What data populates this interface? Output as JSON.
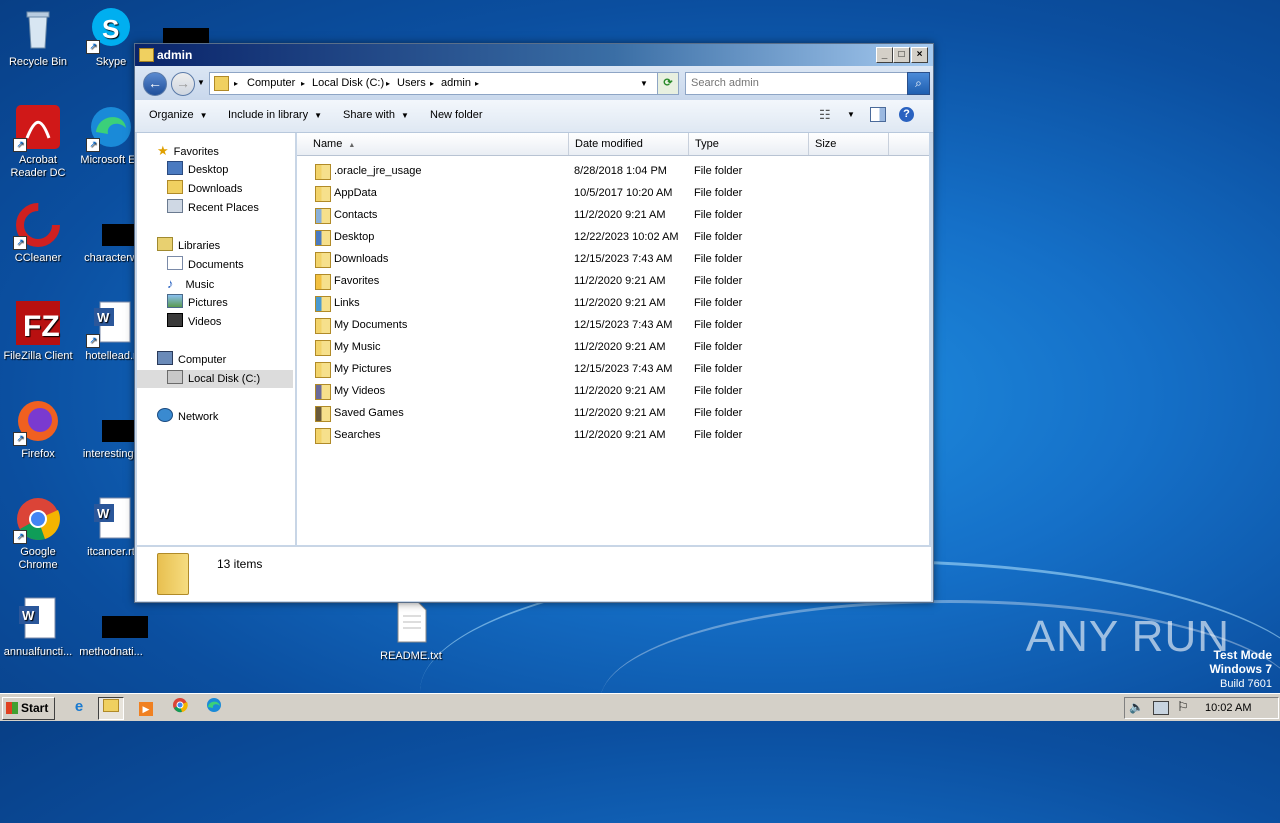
{
  "desktop": {
    "icons": [
      {
        "label": "Recycle Bin"
      },
      {
        "label": "Skype"
      },
      {
        "label": "Acrobat Reader DC"
      },
      {
        "label": "Microsoft Ed"
      },
      {
        "label": "CCleaner"
      },
      {
        "label": "characterw"
      },
      {
        "label": "FileZilla Client"
      },
      {
        "label": "hotellead.r"
      },
      {
        "label": "Firefox"
      },
      {
        "label": "interestingc"
      },
      {
        "label": "Google Chrome"
      },
      {
        "label": "itcancer.rt"
      },
      {
        "label": "annualfuncti..."
      },
      {
        "label": "methodnati..."
      },
      {
        "label": "README.txt"
      }
    ]
  },
  "window": {
    "title": "admin",
    "address": {
      "crumbs": [
        "Computer",
        "Local Disk (C:)",
        "Users",
        "admin"
      ]
    },
    "search": {
      "placeholder": "Search admin"
    },
    "toolbar": {
      "organize": "Organize",
      "include_in_library": "Include in library",
      "share_with": "Share with",
      "new_folder": "New folder"
    },
    "nav": {
      "favorites": "Favorites",
      "desktop": "Desktop",
      "downloads": "Downloads",
      "recent_places": "Recent Places",
      "libraries": "Libraries",
      "documents": "Documents",
      "music": "Music",
      "pictures": "Pictures",
      "videos": "Videos",
      "computer": "Computer",
      "local_disk": "Local Disk (C:)",
      "network": "Network"
    },
    "columns": {
      "name": "Name",
      "date": "Date modified",
      "type": "Type",
      "size": "Size"
    },
    "files": [
      {
        "name": ".oracle_jre_usage",
        "date": "8/28/2018 1:04 PM",
        "type": "File folder"
      },
      {
        "name": "AppData",
        "date": "10/5/2017 10:20 AM",
        "type": "File folder"
      },
      {
        "name": "Contacts",
        "date": "11/2/2020 9:21 AM",
        "type": "File folder"
      },
      {
        "name": "Desktop",
        "date": "12/22/2023 10:02 AM",
        "type": "File folder"
      },
      {
        "name": "Downloads",
        "date": "12/15/2023 7:43 AM",
        "type": "File folder"
      },
      {
        "name": "Favorites",
        "date": "11/2/2020 9:21 AM",
        "type": "File folder"
      },
      {
        "name": "Links",
        "date": "11/2/2020 9:21 AM",
        "type": "File folder"
      },
      {
        "name": "My Documents",
        "date": "12/15/2023 7:43 AM",
        "type": "File folder"
      },
      {
        "name": "My Music",
        "date": "11/2/2020 9:21 AM",
        "type": "File folder"
      },
      {
        "name": "My Pictures",
        "date": "12/15/2023 7:43 AM",
        "type": "File folder"
      },
      {
        "name": "My Videos",
        "date": "11/2/2020 9:21 AM",
        "type": "File folder"
      },
      {
        "name": "Saved Games",
        "date": "11/2/2020 9:21 AM",
        "type": "File folder"
      },
      {
        "name": "Searches",
        "date": "11/2/2020 9:21 AM",
        "type": "File folder"
      }
    ],
    "status": {
      "count": "13 items"
    }
  },
  "taskbar": {
    "start": "Start",
    "clock": "10:02 AM"
  },
  "watermark": {
    "brand": "ANY RUN",
    "line1": "Test Mode",
    "line2": "Windows 7",
    "line3": "Build 7601"
  }
}
